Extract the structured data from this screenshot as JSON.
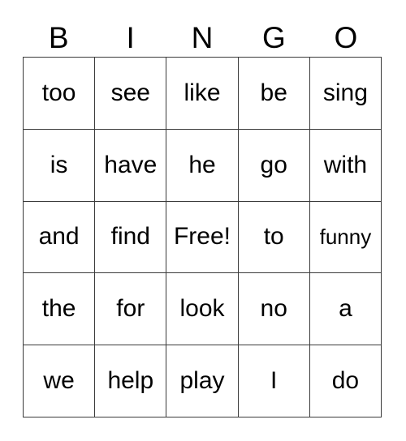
{
  "card": {
    "headers": [
      "B",
      "I",
      "N",
      "G",
      "O"
    ],
    "rows": [
      [
        "too",
        "see",
        "like",
        "be",
        "sing"
      ],
      [
        "is",
        "have",
        "he",
        "go",
        "with"
      ],
      [
        "and",
        "find",
        "Free!",
        "to",
        "funny"
      ],
      [
        "the",
        "for",
        "look",
        "no",
        "a"
      ],
      [
        "we",
        "help",
        "play",
        "I",
        "do"
      ]
    ],
    "free_space": {
      "row": 2,
      "col": 2,
      "label": "Free!"
    },
    "colors": {
      "background": "#ffffff",
      "text": "#000000",
      "grid_line": "#3a3a3a"
    }
  }
}
